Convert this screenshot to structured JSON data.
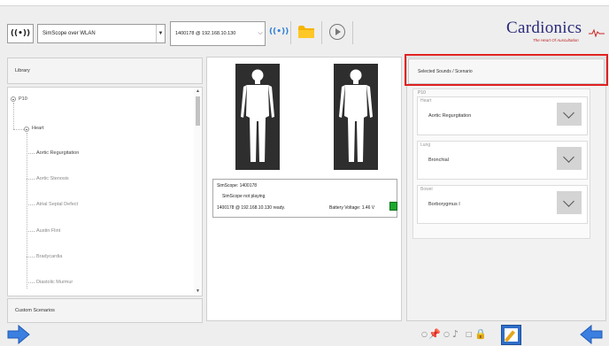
{
  "toolbar": {
    "wifi_button_label": "((•))",
    "connection_value": "SimScope over WLAN",
    "device_value": "1400178 @ 192.168.10.130",
    "icons": [
      "wifi-icon",
      "folder-icon",
      "play-icon"
    ],
    "folder_color": "#f5b400"
  },
  "logo": {
    "name": "Cardionics",
    "tagline": "The Heart Of Auscultation"
  },
  "library": {
    "header": "Library",
    "root": "P10",
    "group": "Heart",
    "items": [
      "Aortic Regurgitation",
      "Aortic Stenosis",
      "Atrial Septal Defect",
      "Austin Flint",
      "Bradycardia",
      "Diastolic Murmur"
    ],
    "custom_header": "Custom Scenarios"
  },
  "status": {
    "line1": "SimScope: 1400178",
    "line2": "SimScope not playing",
    "line3": "1400178 @ 192.168.10.130 ready.",
    "battery": "Battery Voltage: 1.46 V",
    "battery_color": "#1aa82c"
  },
  "scenario": {
    "header": "Selected Sounds / Scenario",
    "panel_title": "P10",
    "groups": [
      {
        "label": "Heart",
        "value": "Aortic Regurgitation"
      },
      {
        "label": "Lung",
        "value": "Bronchial"
      },
      {
        "label": "Bowel",
        "value": "Borborygmus I"
      }
    ],
    "highlight_color": "#e02020"
  }
}
